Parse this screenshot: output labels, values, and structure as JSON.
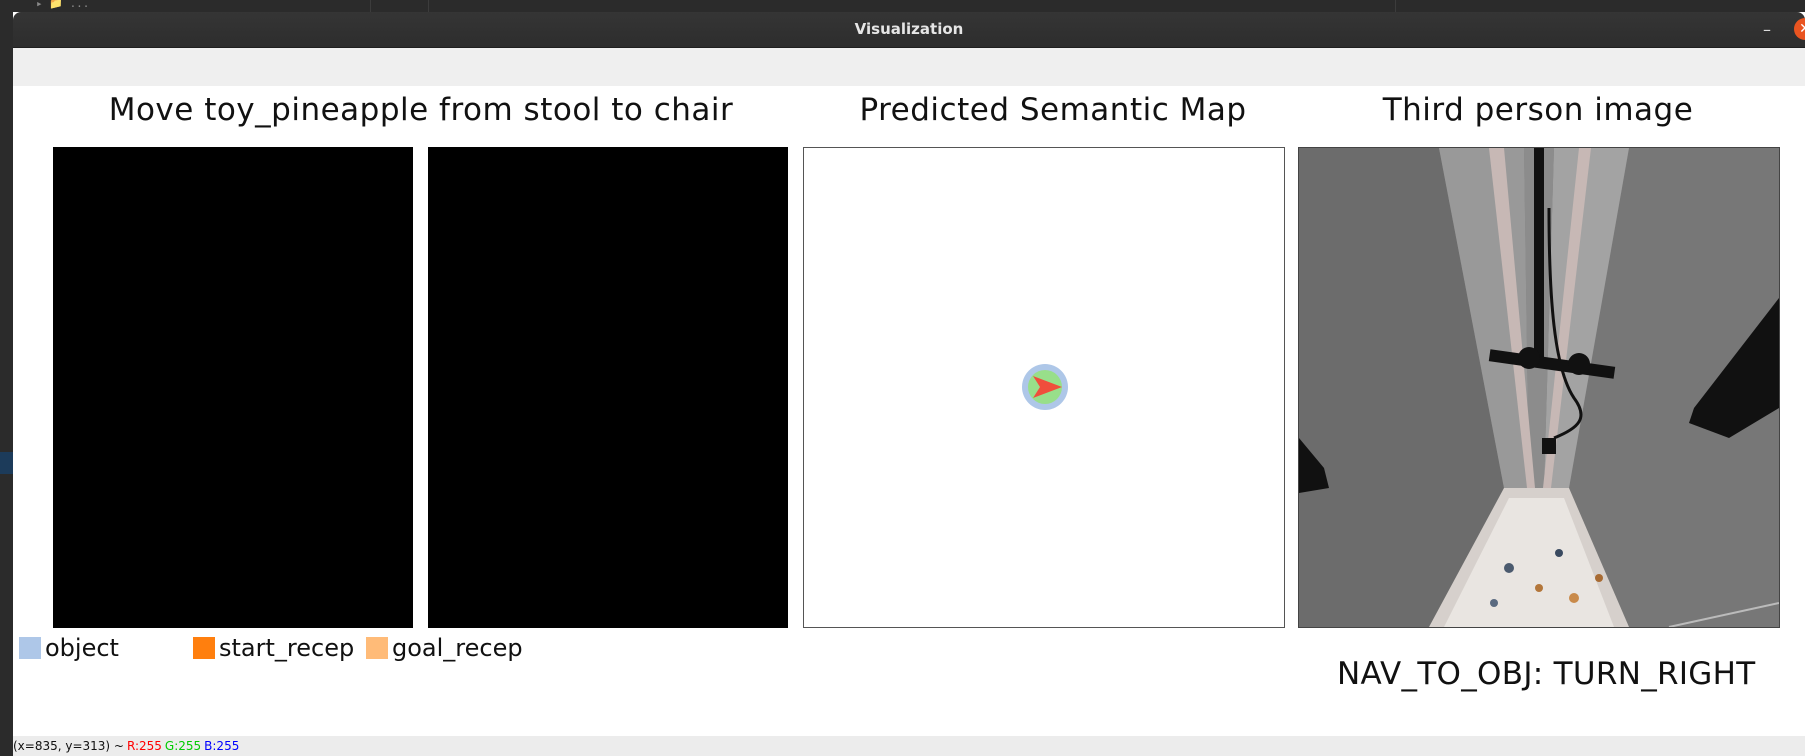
{
  "window": {
    "title": "Visualization",
    "minimize_glyph": "–",
    "close_glyph": "✕"
  },
  "headings": {
    "task": "Move toy_pineapple from stool to chair",
    "semantic_map": "Predicted Semantic Map",
    "third_person": "Third person image"
  },
  "legend": [
    {
      "label": "object",
      "color": "#aec7e8"
    },
    {
      "label": "start_recep",
      "color": "#ff7f0e"
    },
    {
      "label": "goal_recep",
      "color": "#ffbb78"
    }
  ],
  "action": "NAV_TO_OBJ: TURN_RIGHT",
  "agent_marker": {
    "ring_color": "#aec7e8",
    "inner_color": "#98df8a",
    "arrow_color": "#f04e3c",
    "heading": "right"
  },
  "statusbar": {
    "coords": "(x=835, y=313) ~",
    "r": "R:255",
    "g": "G:255",
    "b": "B:255",
    "r_color": "#ff0000",
    "g_color": "#00cc00",
    "b_color": "#0000ff"
  },
  "background": {
    "explorer_text": "▸ 📁 ..."
  }
}
